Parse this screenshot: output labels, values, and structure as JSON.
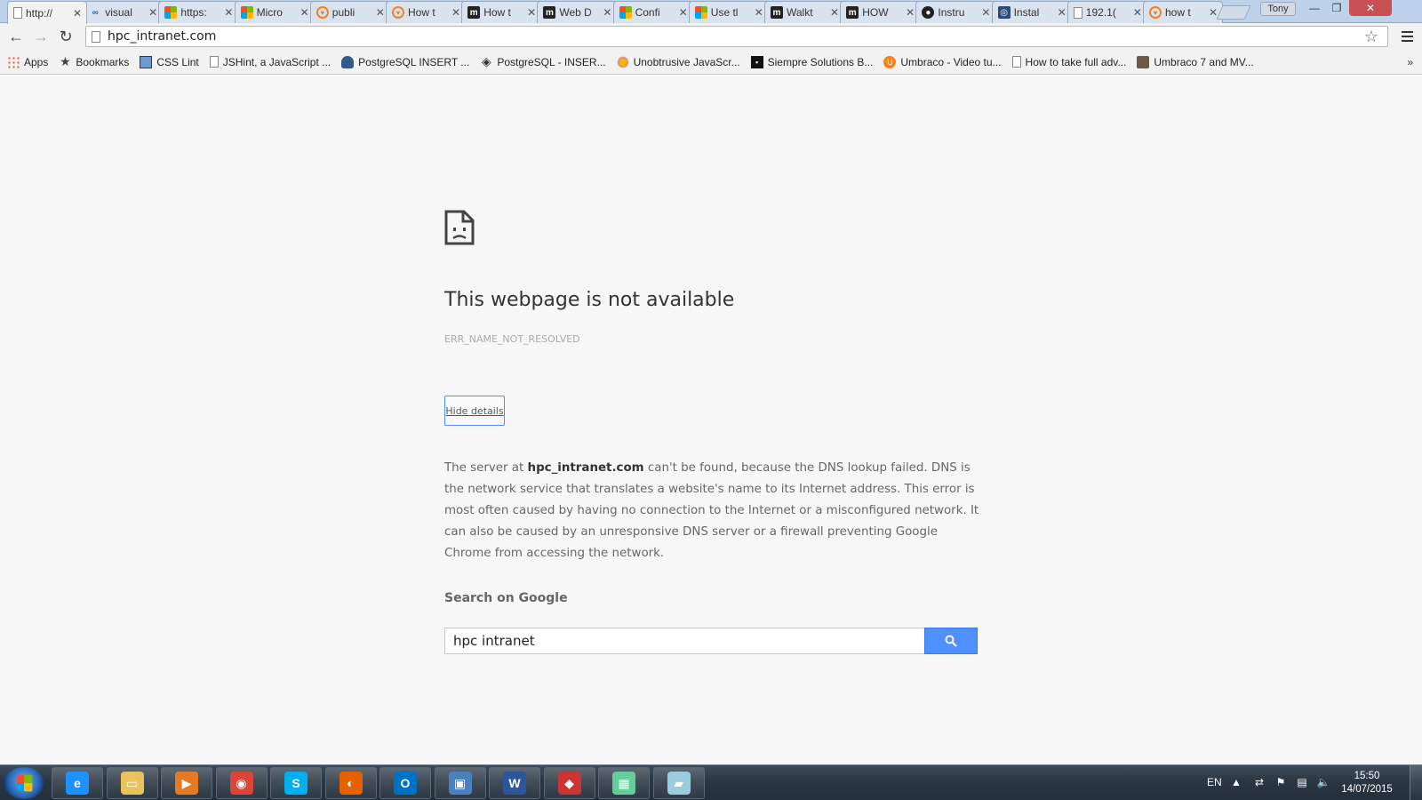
{
  "browser": {
    "tabs": [
      {
        "title": "http://",
        "favicon": "page-icon",
        "active": true
      },
      {
        "title": "visual",
        "favicon": "visual-studio-icon"
      },
      {
        "title": "https:",
        "favicon": "microsoft-icon"
      },
      {
        "title": "Micro",
        "favicon": "microsoft-icon"
      },
      {
        "title": "publi",
        "favicon": "stackoverflow-icon"
      },
      {
        "title": "How t",
        "favicon": "stackoverflow-icon"
      },
      {
        "title": "How t",
        "favicon": "m-icon"
      },
      {
        "title": "Web D",
        "favicon": "m-icon"
      },
      {
        "title": "Confi",
        "favicon": "microsoft-icon"
      },
      {
        "title": "Use tl",
        "favicon": "microsoft-icon"
      },
      {
        "title": "Walkt",
        "favicon": "m-icon"
      },
      {
        "title": "HOW",
        "favicon": "m-icon"
      },
      {
        "title": "Instru",
        "favicon": "github-icon"
      },
      {
        "title": "Instal",
        "favicon": "installer-icon"
      },
      {
        "title": "192.1(",
        "favicon": "page-icon"
      },
      {
        "title": "how t",
        "favicon": "stackoverflow-icon"
      }
    ],
    "profile_name": "Tony",
    "url": "hpc_intranet.com",
    "bookmarks": [
      {
        "label": "Apps",
        "icon": "apps-grid-icon"
      },
      {
        "label": "Bookmarks",
        "icon": "star-icon"
      },
      {
        "label": "CSS Lint",
        "icon": "csslint-icon"
      },
      {
        "label": "JSHint, a JavaScript ...",
        "icon": "page-icon"
      },
      {
        "label": "PostgreSQL INSERT ...",
        "icon": "postgresql-icon"
      },
      {
        "label": "PostgreSQL - INSER...",
        "icon": "diamond-icon"
      },
      {
        "label": "Unobtrusive JavaScr...",
        "icon": "sun-icon"
      },
      {
        "label": "Siempre Solutions B...",
        "icon": "siempre-icon"
      },
      {
        "label": "Umbraco - Video tu...",
        "icon": "umbraco-icon"
      },
      {
        "label": "How to take full adv...",
        "icon": "page-icon"
      },
      {
        "label": "Umbraco 7 and MV...",
        "icon": "photo-icon"
      }
    ],
    "bookmarks_more": "»"
  },
  "error_page": {
    "title": "This webpage is not available",
    "code": "ERR_NAME_NOT_RESOLVED",
    "details_button": "Hide details",
    "details_prefix": "The server at ",
    "details_host": "hpc_intranet.com",
    "details_suffix": " can't be found, because the DNS lookup failed. DNS is the network service that translates a website's name to its Internet address. This error is most often caused by having no connection to the Internet or a misconfigured network. It can also be caused by an unresponsive DNS server or a firewall preventing Google Chrome from accessing the network.",
    "search_heading": "Search on Google",
    "search_value": "hpc intranet"
  },
  "taskbar": {
    "apps": [
      {
        "name": "internet-explorer",
        "glyph": "e",
        "color": "#1e90ff"
      },
      {
        "name": "file-explorer",
        "glyph": "▭",
        "color": "#e8c25a"
      },
      {
        "name": "media-player",
        "glyph": "▶",
        "color": "#e67a22"
      },
      {
        "name": "chrome",
        "glyph": "◉",
        "color": "#db4437"
      },
      {
        "name": "skype",
        "glyph": "S",
        "color": "#00aff0"
      },
      {
        "name": "firefox",
        "glyph": "◐",
        "color": "#e66000"
      },
      {
        "name": "outlook",
        "glyph": "O",
        "color": "#0072c6"
      },
      {
        "name": "server-manager",
        "glyph": "▣",
        "color": "#4a7fc0"
      },
      {
        "name": "word",
        "glyph": "W",
        "color": "#2b579a"
      },
      {
        "name": "virtualbox",
        "glyph": "◆",
        "color": "#c33"
      },
      {
        "name": "network-tool",
        "glyph": "▦",
        "color": "#6c9"
      },
      {
        "name": "notepad",
        "glyph": "▰",
        "color": "#9cd"
      }
    ],
    "language": "EN",
    "time": "15:50",
    "date": "14/07/2015"
  }
}
